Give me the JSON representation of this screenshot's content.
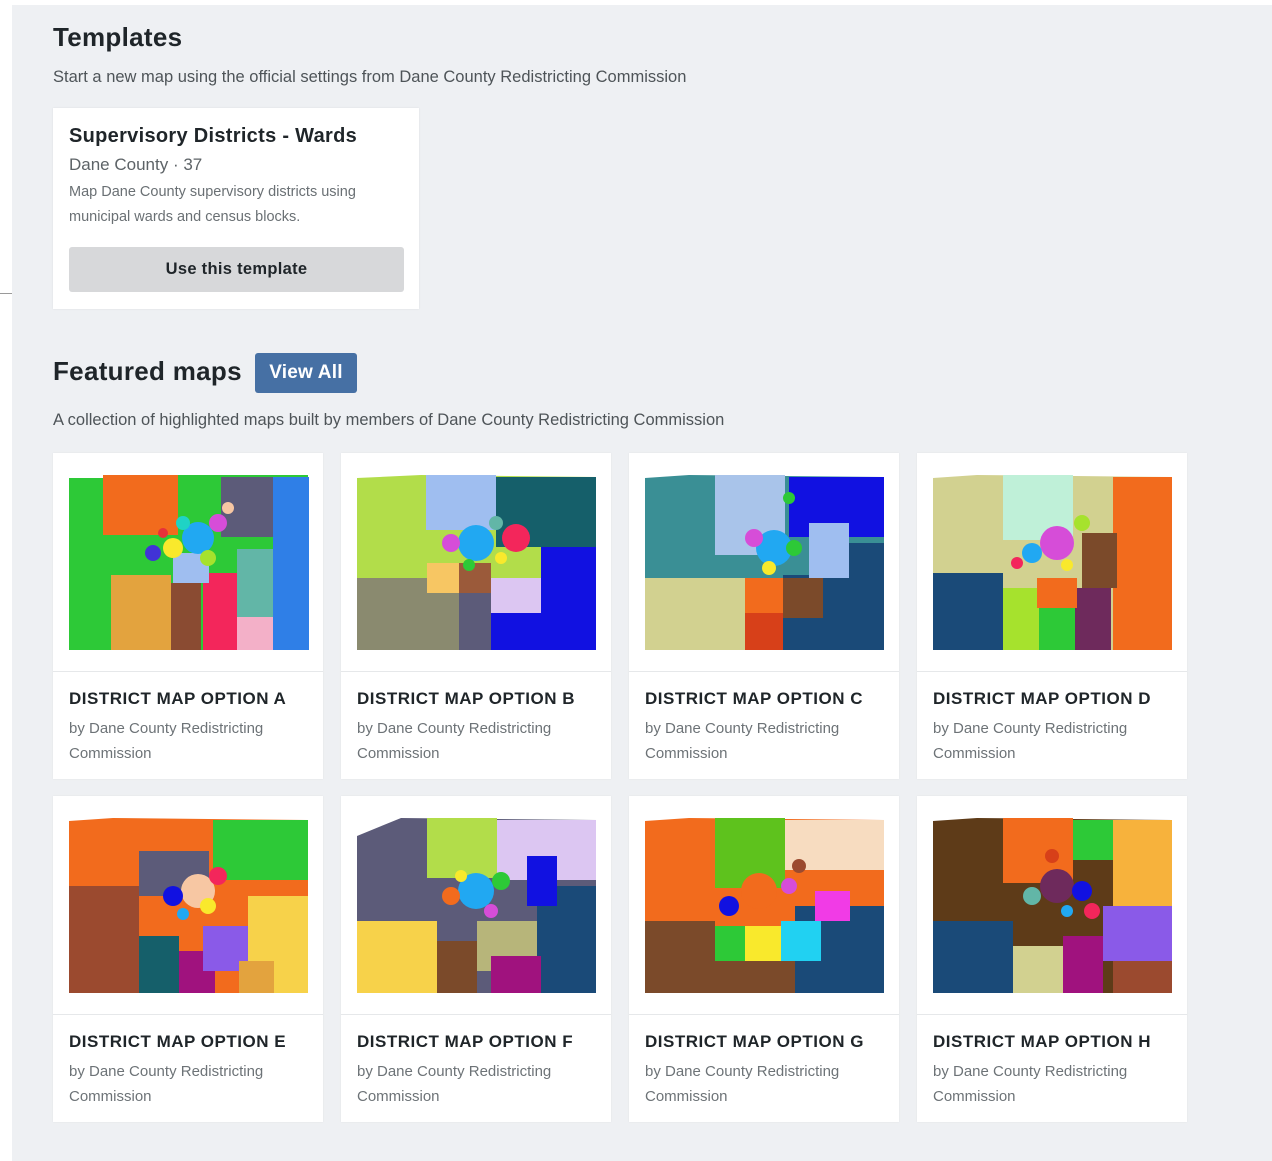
{
  "templates": {
    "title": "Templates",
    "description": "Start a new map using the official settings from Dane County Redistricting Commission",
    "card": {
      "title": "Supervisory Districts - Wards",
      "subtitle": "Dane County · 37",
      "description": "Map Dane County supervisory districts using municipal wards and census blocks.",
      "button_label": "Use this template"
    }
  },
  "featured": {
    "title": "Featured maps",
    "view_all_label": "View All",
    "description": "A collection of highlighted maps built by members of Dane County Redistricting Commission",
    "maps": [
      {
        "title": "DISTRICT MAP OPTION A",
        "byline": "by Dane County Redistricting Commission"
      },
      {
        "title": "DISTRICT MAP OPTION B",
        "byline": "by Dane County Redistricting Commission"
      },
      {
        "title": "DISTRICT MAP OPTION C",
        "byline": "by Dane County Redistricting Commission"
      },
      {
        "title": "DISTRICT MAP OPTION D",
        "byline": "by Dane County Redistricting Commission"
      },
      {
        "title": "DISTRICT MAP OPTION E",
        "byline": "by Dane County Redistricting Commission"
      },
      {
        "title": "DISTRICT MAP OPTION F",
        "byline": "by Dane County Redistricting Commission"
      },
      {
        "title": "DISTRICT MAP OPTION G",
        "byline": "by Dane County Redistricting Commission"
      },
      {
        "title": "DISTRICT MAP OPTION H",
        "byline": "by Dane County Redistricting Commission"
      }
    ]
  },
  "colors": {
    "page_bg": "#eef0f3",
    "card_bg": "#ffffff",
    "accent_button": "#4670a4",
    "template_button": "#d7d8da",
    "heading": "#1f2529",
    "muted_text": "#6d7377"
  }
}
